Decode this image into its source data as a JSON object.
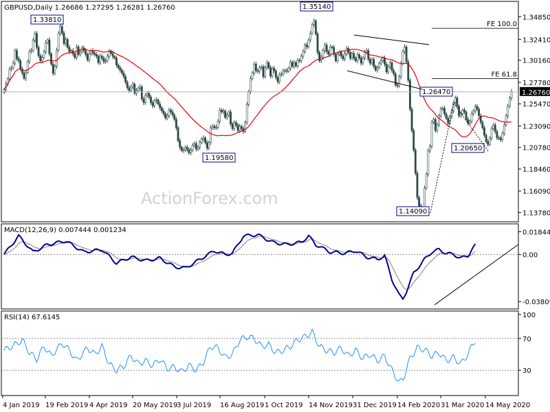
{
  "chart_data": [
    {
      "type": "candlestick",
      "panel": "price",
      "symbol": "GBPUSD",
      "timeframe": "Daily",
      "header_values": {
        "open": "1.26686",
        "high": "1.27295",
        "low": "1.26281",
        "close": "1.26760"
      },
      "ylim": [
        1.13,
        1.362
      ],
      "y_tick_labels": [
        "1.34850",
        "1.32410",
        "1.30160",
        "1.27780",
        "1.25470",
        "1.23090",
        "1.20780",
        "1.18460",
        "1.16090",
        "1.13780"
      ],
      "current_price_label": "1.26760",
      "moving_average_color": "#e00000",
      "candle_color": "#2c4a46",
      "close_series": [
        1.27,
        1.276,
        1.2815,
        1.292,
        1.2935,
        1.2985,
        1.312,
        1.3035,
        1.301,
        1.292,
        1.288,
        1.282,
        1.2885,
        1.3005,
        1.311,
        1.3125,
        1.323,
        1.3305,
        1.3155,
        1.3065,
        1.301,
        1.3045,
        1.311,
        1.3205,
        1.3235,
        1.3085,
        1.2975,
        1.2875,
        1.295,
        1.3125,
        1.3305,
        1.3378,
        1.331,
        1.3195,
        1.324,
        1.3155,
        1.311,
        1.312,
        1.3085,
        1.3045,
        1.316,
        1.308,
        1.311,
        1.315,
        1.312,
        1.308,
        1.302,
        1.3085,
        1.312,
        1.3095,
        1.3075,
        1.306,
        1.299,
        1.306,
        1.304,
        1.3,
        1.301,
        1.306,
        1.311,
        1.309,
        1.3055,
        1.304,
        1.2965,
        1.2935,
        1.291,
        1.288,
        1.284,
        1.278,
        1.272,
        1.269,
        1.273,
        1.276,
        1.266,
        1.269,
        1.2715,
        1.273,
        1.26,
        1.256,
        1.264,
        1.266,
        1.262,
        1.256,
        1.2525,
        1.258,
        1.259,
        1.2545,
        1.2505,
        1.247,
        1.244,
        1.2395,
        1.242,
        1.248,
        1.246,
        1.2425,
        1.238,
        1.229,
        1.215,
        1.208,
        1.2045,
        1.205,
        1.208,
        1.2055,
        1.202,
        1.205,
        1.21,
        1.212,
        1.206,
        1.208,
        1.213,
        1.217,
        1.218,
        1.213,
        1.207,
        1.213,
        1.229,
        1.2305,
        1.229,
        1.2295,
        1.236,
        1.248,
        1.246,
        1.247,
        1.24,
        1.2425,
        1.246,
        1.233,
        1.228,
        1.2345,
        1.232,
        1.226,
        1.2305,
        1.228,
        1.225,
        1.235,
        1.254,
        1.268,
        1.282,
        1.288,
        1.2975,
        1.2905,
        1.2895,
        1.2935,
        1.2945,
        1.284,
        1.294,
        1.299,
        1.2935,
        1.2845,
        1.293,
        1.29,
        1.283,
        1.2785,
        1.286,
        1.287,
        1.29,
        1.2905,
        1.29,
        1.293,
        1.2995,
        1.295,
        1.299,
        1.2955,
        1.3015,
        1.301,
        1.306,
        1.311,
        1.318,
        1.316,
        1.3235,
        1.3305,
        1.34,
        1.344,
        1.33,
        1.31,
        1.301,
        1.305,
        1.312,
        1.318,
        1.311,
        1.308,
        1.316,
        1.3155,
        1.308,
        1.301,
        1.308,
        1.31,
        1.306,
        1.303,
        1.3085,
        1.3145,
        1.31,
        1.304,
        1.309,
        1.304,
        1.301,
        1.3075,
        1.304,
        1.2985,
        1.304,
        1.31,
        1.312,
        1.3025,
        1.2985,
        1.3025,
        1.295,
        1.291,
        1.2935,
        1.2985,
        1.301,
        1.304,
        1.2975,
        1.289,
        1.2945,
        1.299,
        1.2905,
        1.287,
        1.275,
        1.274,
        1.284,
        1.298,
        1.311,
        1.316,
        1.3,
        1.28,
        1.249,
        1.226,
        1.205,
        1.18,
        1.154,
        1.145,
        1.142,
        1.142,
        1.164,
        1.179,
        1.204,
        1.209,
        1.235,
        1.238,
        1.226,
        1.232,
        1.242,
        1.249,
        1.25,
        1.244,
        1.239,
        1.234,
        1.241,
        1.247,
        1.256,
        1.261,
        1.252,
        1.242,
        1.244,
        1.248,
        1.246,
        1.238,
        1.234,
        1.236,
        1.244,
        1.247,
        1.252,
        1.249,
        1.242,
        1.235,
        1.229,
        1.221,
        1.214,
        1.211,
        1.218,
        1.228,
        1.232,
        1.225,
        1.218,
        1.218,
        1.216,
        1.223,
        1.232,
        1.242,
        1.252,
        1.261,
        1.2676
      ],
      "x_tick_labels": [
        "4 Jan 2019",
        "19 Feb 2019",
        "4 Apr 2019",
        "20 May 2019",
        "3 Jul 2019",
        "16 Aug 2019",
        "1 Oct 2019",
        "14 Nov 2019",
        "31 Dec 2019",
        "14 Feb 2020",
        "31 Mar 2020",
        "14 May 2020"
      ],
      "annotations": [
        {
          "text": "1.33810",
          "price": 1.3381
        },
        {
          "text": "1.35140",
          "price": 1.3514
        },
        {
          "text": "1.19580",
          "price": 1.1958
        },
        {
          "text": "1.26470",
          "price": 1.2647
        },
        {
          "text": "1.20650",
          "price": 1.2065
        },
        {
          "text": "1.14090",
          "price": 1.1409
        }
      ],
      "fib_levels": [
        {
          "text": "FE 100.0",
          "price": 1.336
        },
        {
          "text": "FE 61.8",
          "price": 1.2818
        }
      ],
      "watermark": "ActionForex.com"
    },
    {
      "type": "line",
      "panel": "macd",
      "title": "MACD(12,26,9) 0.007444 0.001234",
      "ylim": [
        -0.0425,
        0.0215
      ],
      "y_tick_labels": [
        "0.018442",
        "0.00",
        "-0.038095"
      ],
      "macd_color": "#00008b",
      "signal_color": "#808080",
      "macd_keypoints": [
        [
          0,
          0.0
        ],
        [
          8,
          0.015
        ],
        [
          16,
          0.002
        ],
        [
          24,
          0.008
        ],
        [
          34,
          0.011
        ],
        [
          44,
          0.002
        ],
        [
          54,
          0.004
        ],
        [
          62,
          -0.007
        ],
        [
          70,
          -0.002
        ],
        [
          78,
          -0.005
        ],
        [
          86,
          -0.003
        ],
        [
          94,
          -0.01
        ],
        [
          100,
          -0.011
        ],
        [
          108,
          -0.004
        ],
        [
          116,
          0.003
        ],
        [
          122,
          0.0
        ],
        [
          126,
          0.001
        ],
        [
          132,
          0.015
        ],
        [
          140,
          0.016
        ],
        [
          148,
          0.01
        ],
        [
          156,
          0.008
        ],
        [
          164,
          0.01
        ],
        [
          168,
          0.015
        ],
        [
          172,
          0.008
        ],
        [
          180,
          0.002
        ],
        [
          188,
          0.001
        ],
        [
          194,
          0.003
        ],
        [
          200,
          -0.002
        ],
        [
          206,
          -0.004
        ],
        [
          210,
          -0.001
        ],
        [
          214,
          -0.02
        ],
        [
          218,
          -0.033
        ],
        [
          220,
          -0.036
        ],
        [
          222,
          -0.03
        ],
        [
          226,
          -0.015
        ],
        [
          232,
          -0.004
        ],
        [
          236,
          0.002
        ],
        [
          240,
          0.004
        ],
        [
          244,
          0.001
        ],
        [
          248,
          0.0
        ],
        [
          252,
          -0.003
        ],
        [
          256,
          -0.001
        ],
        [
          258,
          0.004
        ],
        [
          260,
          0.0074
        ]
      ],
      "trendline_note": "support trendline from MACD low"
    },
    {
      "type": "line",
      "panel": "rsi",
      "title": "RSI(14) 67.6145",
      "ylim": [
        0,
        100
      ],
      "y_tick_labels": [
        "100",
        "70",
        "30",
        "0"
      ],
      "guide_levels": [
        70,
        30
      ],
      "rsi_color": "#1e90ff",
      "rsi_keypoints": [
        [
          0,
          55
        ],
        [
          6,
          62
        ],
        [
          10,
          68
        ],
        [
          14,
          52
        ],
        [
          18,
          44
        ],
        [
          22,
          60
        ],
        [
          26,
          48
        ],
        [
          32,
          64
        ],
        [
          36,
          55
        ],
        [
          40,
          42
        ],
        [
          46,
          58
        ],
        [
          50,
          50
        ],
        [
          54,
          60
        ],
        [
          58,
          38
        ],
        [
          62,
          30
        ],
        [
          66,
          35
        ],
        [
          70,
          48
        ],
        [
          74,
          38
        ],
        [
          78,
          42
        ],
        [
          82,
          36
        ],
        [
          86,
          44
        ],
        [
          90,
          32
        ],
        [
          94,
          34
        ],
        [
          98,
          28
        ],
        [
          102,
          36
        ],
        [
          106,
          30
        ],
        [
          110,
          40
        ],
        [
          114,
          60
        ],
        [
          118,
          58
        ],
        [
          122,
          46
        ],
        [
          126,
          50
        ],
        [
          130,
          68
        ],
        [
          134,
          72
        ],
        [
          138,
          70
        ],
        [
          142,
          60
        ],
        [
          146,
          62
        ],
        [
          150,
          52
        ],
        [
          154,
          55
        ],
        [
          158,
          60
        ],
        [
          162,
          68
        ],
        [
          166,
          72
        ],
        [
          170,
          78
        ],
        [
          174,
          60
        ],
        [
          178,
          55
        ],
        [
          182,
          52
        ],
        [
          186,
          58
        ],
        [
          190,
          48
        ],
        [
          194,
          55
        ],
        [
          198,
          45
        ],
        [
          202,
          50
        ],
        [
          206,
          42
        ],
        [
          210,
          48
        ],
        [
          214,
          30
        ],
        [
          218,
          15
        ],
        [
          220,
          18
        ],
        [
          224,
          45
        ],
        [
          228,
          58
        ],
        [
          232,
          56
        ],
        [
          236,
          48
        ],
        [
          240,
          52
        ],
        [
          244,
          42
        ],
        [
          248,
          46
        ],
        [
          252,
          38
        ],
        [
          256,
          50
        ],
        [
          258,
          60
        ],
        [
          260,
          67.6
        ]
      ]
    }
  ]
}
